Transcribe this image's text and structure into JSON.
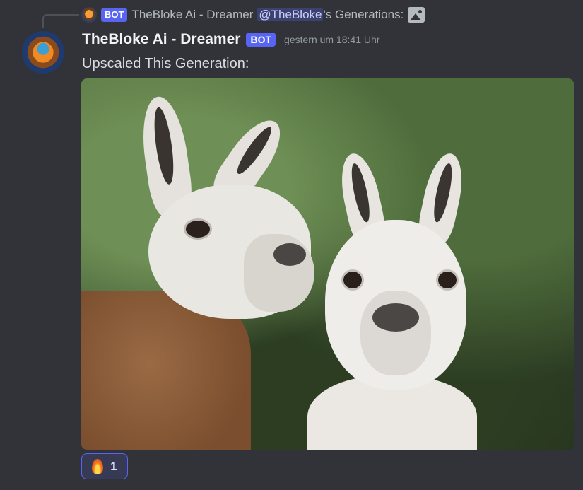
{
  "reply": {
    "bot_tag": "BOT",
    "author": "TheBloke Ai - Dreamer",
    "mention": "@TheBloke",
    "suffix": "'s Generations:"
  },
  "message": {
    "author": "TheBloke Ai - Dreamer",
    "bot_tag": "BOT",
    "timestamp": "gestern um 18:41 Uhr",
    "text": "Upscaled This Generation:"
  },
  "reaction": {
    "emoji": "fire",
    "count": "1"
  },
  "colors": {
    "background": "#313338",
    "bot_badge": "#5865f2",
    "mention_bg": "#3c4270",
    "reaction_border": "#5865f2"
  }
}
